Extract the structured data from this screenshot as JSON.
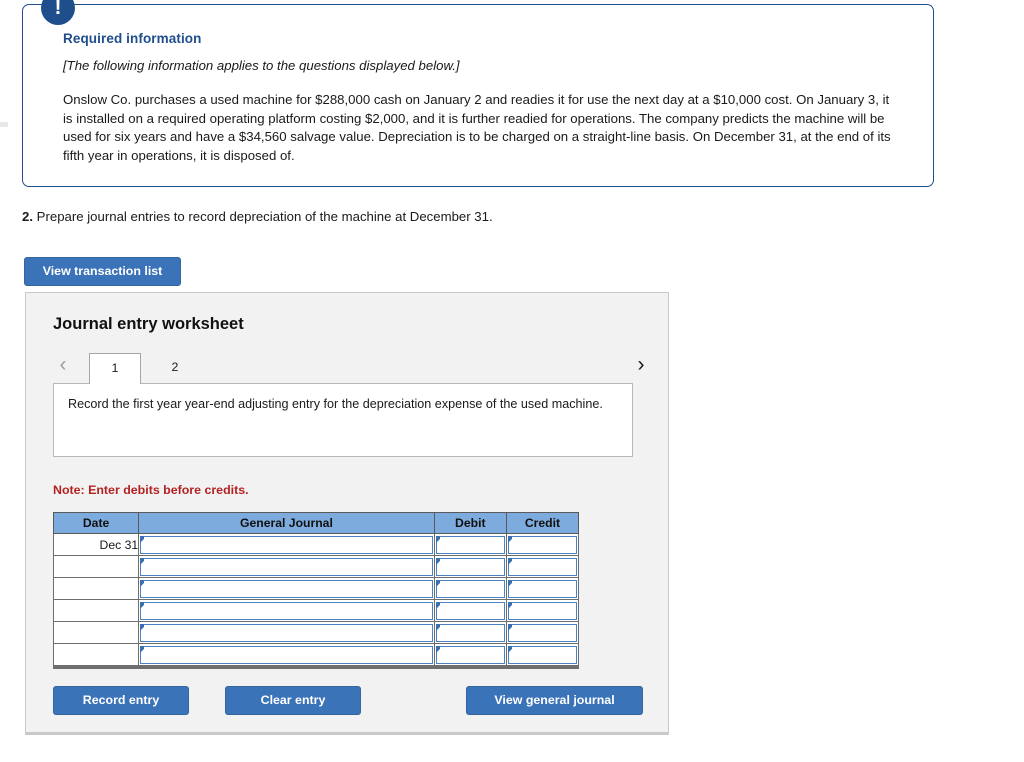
{
  "required_information": {
    "badge_icon": "exclamation-icon",
    "title": "Required information",
    "subtitle": "[The following information applies to the questions displayed below.]",
    "body": "Onslow Co. purchases a used machine for $288,000 cash on January 2 and readies it for use the next day at a $10,000 cost. On January 3, it is installed on a required operating platform costing $2,000, and it is further readied for operations. The company predicts the machine will be used for six years and have a $34,560 salvage value. Depreciation is to be charged on a straight-line basis. On December 31, at the end of its fifth year in operations, it is disposed of."
  },
  "question": {
    "number": "2.",
    "text": "Prepare journal entries to record depreciation of the machine at December 31."
  },
  "toolbar": {
    "view_transaction_list_label": "View transaction list"
  },
  "worksheet": {
    "title": "Journal entry worksheet",
    "nav": {
      "prev_icon": "chevron-left-icon",
      "next_icon": "chevron-right-icon"
    },
    "tabs": [
      {
        "label": "1",
        "active": true
      },
      {
        "label": "2",
        "active": false
      }
    ],
    "instruction": "Record the first year year-end adjusting entry for the depreciation expense of the used machine.",
    "note": "Note: Enter debits before credits.",
    "table": {
      "columns": [
        "Date",
        "General Journal",
        "Debit",
        "Credit"
      ],
      "rows": [
        {
          "date": "Dec 31",
          "general_journal": "",
          "debit": "",
          "credit": ""
        },
        {
          "date": "",
          "general_journal": "",
          "debit": "",
          "credit": ""
        },
        {
          "date": "",
          "general_journal": "",
          "debit": "",
          "credit": ""
        },
        {
          "date": "",
          "general_journal": "",
          "debit": "",
          "credit": ""
        },
        {
          "date": "",
          "general_journal": "",
          "debit": "",
          "credit": ""
        },
        {
          "date": "",
          "general_journal": "",
          "debit": "",
          "credit": ""
        }
      ]
    },
    "actions": {
      "record_entry_label": "Record entry",
      "clear_entry_label": "Clear entry",
      "view_general_journal_label": "View general journal"
    }
  },
  "colors": {
    "accent_blue": "#3b73b9",
    "navy": "#1f4e8c",
    "table_header_blue": "#7eabdd",
    "note_red": "#b32222",
    "panel_gray": "#f2f2f2"
  }
}
